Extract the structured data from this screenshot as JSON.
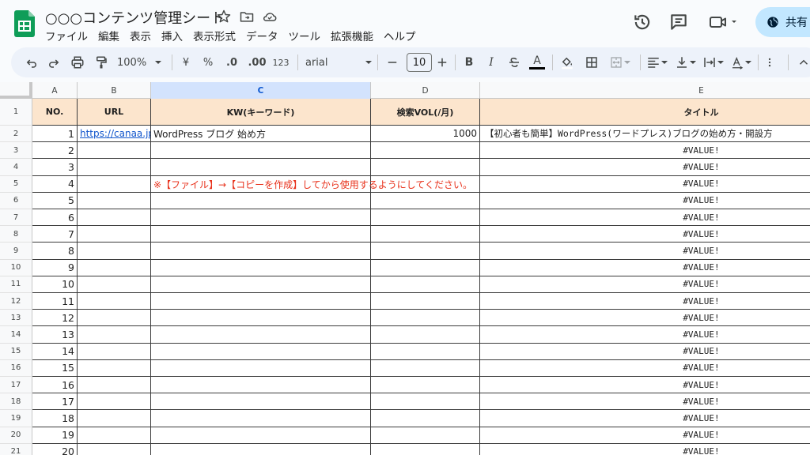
{
  "app": {
    "title": "○○○コンテンツ管理シート"
  },
  "menu": [
    "ファイル",
    "編集",
    "表示",
    "挿入",
    "表示形式",
    "データ",
    "ツール",
    "拡張機能",
    "ヘルプ"
  ],
  "share": {
    "label": "共有"
  },
  "toolbar": {
    "zoom": "100%",
    "currency": "¥",
    "percent": "%",
    "dec_decrease": ".0",
    "dec_increase": ".00",
    "number_format": "123",
    "font": "arial",
    "font_size": "10",
    "bold": "B",
    "italic": "I",
    "text_color_letter": "A",
    "text_color_accent": "#000000"
  },
  "columns": [
    "A",
    "B",
    "C",
    "D",
    "E"
  ],
  "selected_column": "C",
  "header_row": {
    "no": "NO.",
    "url": "URL",
    "kw": "KW(キーワード)",
    "vol": "検索VOL(/月)",
    "title": "タイトル"
  },
  "row1": {
    "no": "1",
    "url": "https://canaa.jp/r",
    "kw": "WordPress ブログ 始め方",
    "vol": "1000",
    "title": "【初心者も簡単】WordPress(ワードプレス)ブログの始め方・開設方"
  },
  "note": "※【ファイル】→【コピーを作成】してから使用するようにしてください。",
  "error_value": "#VALUE!",
  "row_numbers": [
    "1",
    "2",
    "3",
    "4",
    "5",
    "6",
    "7",
    "8",
    "9",
    "10",
    "11",
    "12",
    "13",
    "14",
    "15",
    "16",
    "17",
    "18",
    "19",
    "20",
    "21"
  ],
  "no_values": [
    "2",
    "3",
    "4",
    "5",
    "6",
    "7",
    "8",
    "9",
    "10",
    "11",
    "12",
    "13",
    "14",
    "15",
    "16",
    "17",
    "18",
    "19",
    "20"
  ],
  "colors": {
    "header_fill": "#fce5cd",
    "selected_col": "#d3e3fd",
    "note_red": "#e8311b",
    "share_bg": "#c2e7ff",
    "logo_green": "#0f9d58"
  }
}
